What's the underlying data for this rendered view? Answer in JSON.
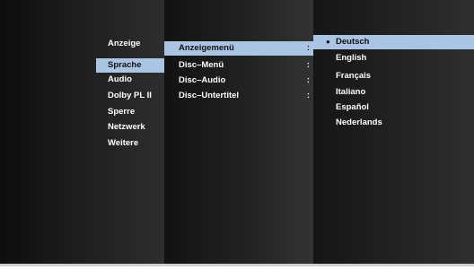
{
  "left_menu": {
    "items": [
      {
        "label": "Anzeige",
        "selected": false
      },
      {
        "label": "Sprache",
        "selected": true
      },
      {
        "label": "Audio",
        "selected": false
      },
      {
        "label": "Dolby PL II",
        "selected": false
      },
      {
        "label": "Sperre",
        "selected": false
      },
      {
        "label": "Netzwerk",
        "selected": false
      },
      {
        "label": "Weitere",
        "selected": false
      }
    ]
  },
  "mid_menu": {
    "separator": ":",
    "items": [
      {
        "label": "Anzeigemenü",
        "selected": true
      },
      {
        "label": "Disc–Menü",
        "selected": false
      },
      {
        "label": "Disc–Audio",
        "selected": false
      },
      {
        "label": "Disc–Untertitel",
        "selected": false
      }
    ]
  },
  "right_menu": {
    "bullet": "●",
    "items": [
      {
        "label": "Deutsch",
        "selected": true
      },
      {
        "label": "English",
        "selected": false
      },
      {
        "label": "Français",
        "selected": false
      },
      {
        "label": "Italiano",
        "selected": false
      },
      {
        "label": "Español",
        "selected": false
      },
      {
        "label": "Nederlands",
        "selected": false
      }
    ]
  },
  "colors": {
    "highlight": "#aac4e4",
    "text": "#ffffff",
    "selected_text": "#111111"
  }
}
